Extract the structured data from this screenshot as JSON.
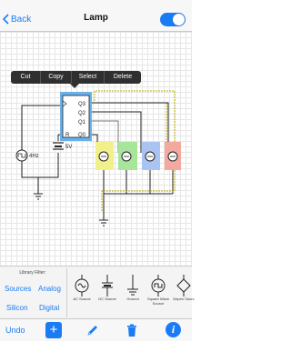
{
  "nav": {
    "back_label": "Back",
    "title": "Lamp",
    "toggle_on": true
  },
  "context_menu": {
    "items": [
      "Cut",
      "Copy",
      "Select",
      "Delete"
    ]
  },
  "circuit": {
    "counter": {
      "pins_right": [
        "Q3",
        "Q2",
        "Q1",
        "Q0"
      ],
      "pins_left": [
        "R"
      ]
    },
    "clock_label": "4Hz",
    "battery_label": "5V",
    "lamp_colors": [
      "#f2f08a",
      "#a6e59a",
      "#a9c3f2",
      "#f3a8a0"
    ],
    "wire_colors": [
      "#222222",
      "#777777",
      "#bfb100"
    ]
  },
  "library": {
    "filter_title": "Library Filter:",
    "filters": [
      "Sources",
      "Analog",
      "Silicon",
      "Digital"
    ],
    "items": [
      {
        "label": "AC Source",
        "icon": "ac-source-icon"
      },
      {
        "label": "DC Source",
        "icon": "dc-source-icon"
      },
      {
        "label": "Ground",
        "icon": "ground-icon"
      },
      {
        "label": "Square Wave Source",
        "icon": "square-wave-icon"
      },
      {
        "label": "Depen Sourc",
        "icon": "dependent-source-icon"
      }
    ]
  },
  "toolbar": {
    "undo_label": "Undo",
    "add_label": "+",
    "info_label": "i"
  },
  "colors": {
    "accent": "#1a7cf5",
    "menu_bg": "#2f2f2f",
    "selection": "#6ab1ea"
  }
}
